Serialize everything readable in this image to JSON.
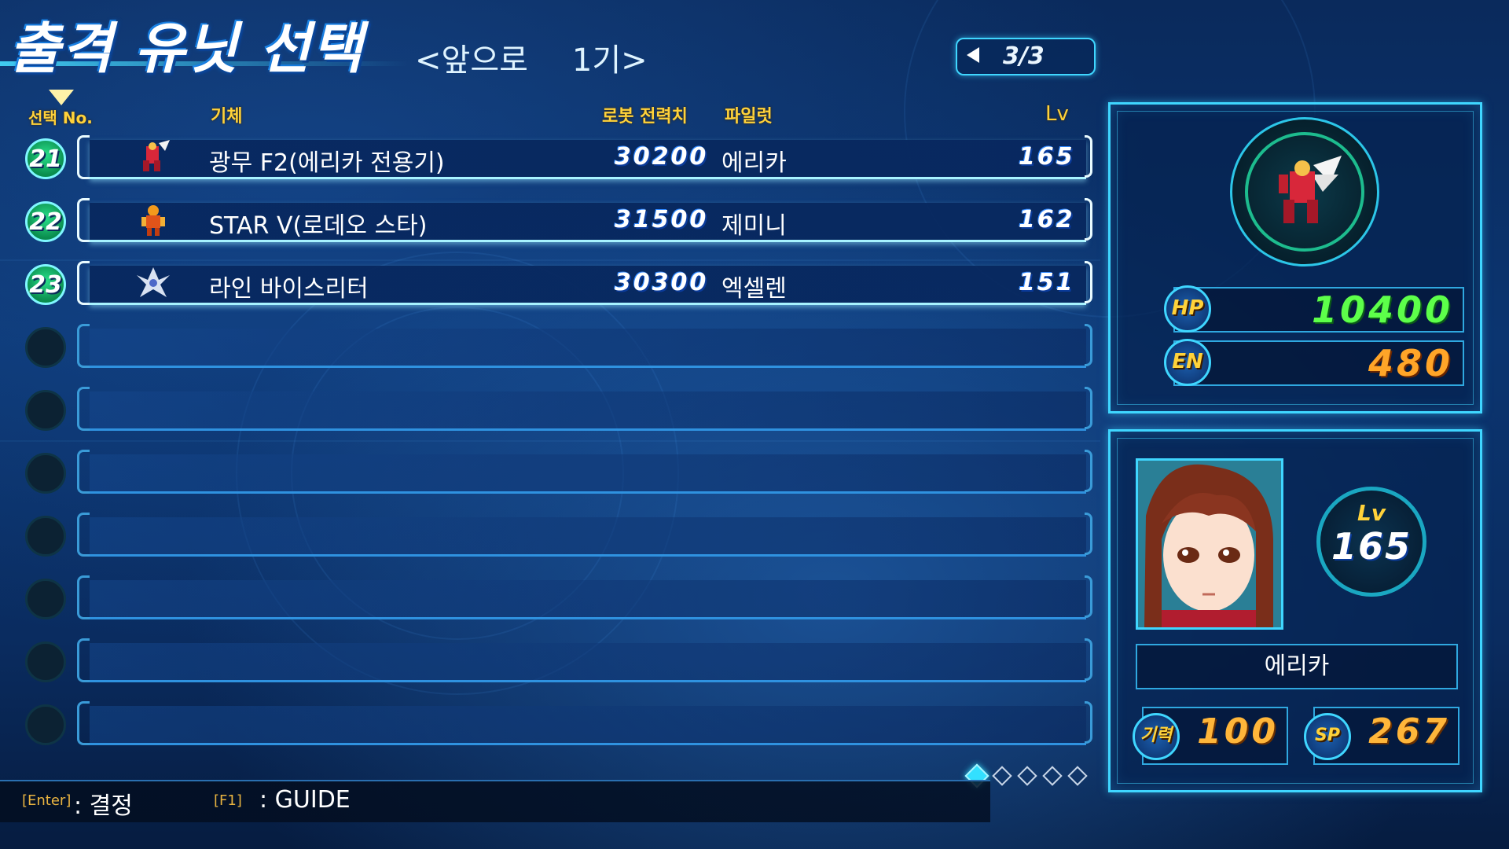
{
  "header": {
    "title": "출격 유닛 선택",
    "remain_label": "<앞으로",
    "remain_count": "1기>",
    "page": "3/3"
  },
  "columns": {
    "select_no": "선택 No.",
    "unit": "기체",
    "power": "로봇 전력치",
    "pilot": "파일럿",
    "level": "Lv"
  },
  "rows": [
    {
      "no": "21",
      "unit": "광무 F2(에리카 전용기)",
      "power": "30200",
      "pilot": "에리카",
      "level": "165",
      "selected": true
    },
    {
      "no": "22",
      "unit": "STAR V(로데오 스타)",
      "power": "31500",
      "pilot": "제미니",
      "level": "162",
      "selected": true
    },
    {
      "no": "23",
      "unit": "라인 바이스리터",
      "power": "30300",
      "pilot": "엑셀렌",
      "level": "151",
      "selected": true
    }
  ],
  "unit_status": {
    "hp_label": "HP",
    "hp": "10400",
    "en_label": "EN",
    "en": "480"
  },
  "pilot_status": {
    "lv_label": "Lv",
    "level": "165",
    "name": "에리카",
    "morale_label": "기력",
    "morale": "100",
    "sp_label": "SP",
    "sp": "267"
  },
  "footer": {
    "enter_key": "[Enter]",
    "enter_desc": ": 결정",
    "f1_key": "[F1]",
    "f1_desc": ": GUIDE"
  },
  "colors": {
    "accent": "#3fd6ff",
    "header_gold": "#ffd23a",
    "hp_green": "#5dff4a",
    "en_orange": "#ffa528"
  },
  "page_dots": {
    "total": 5,
    "active": 1
  }
}
